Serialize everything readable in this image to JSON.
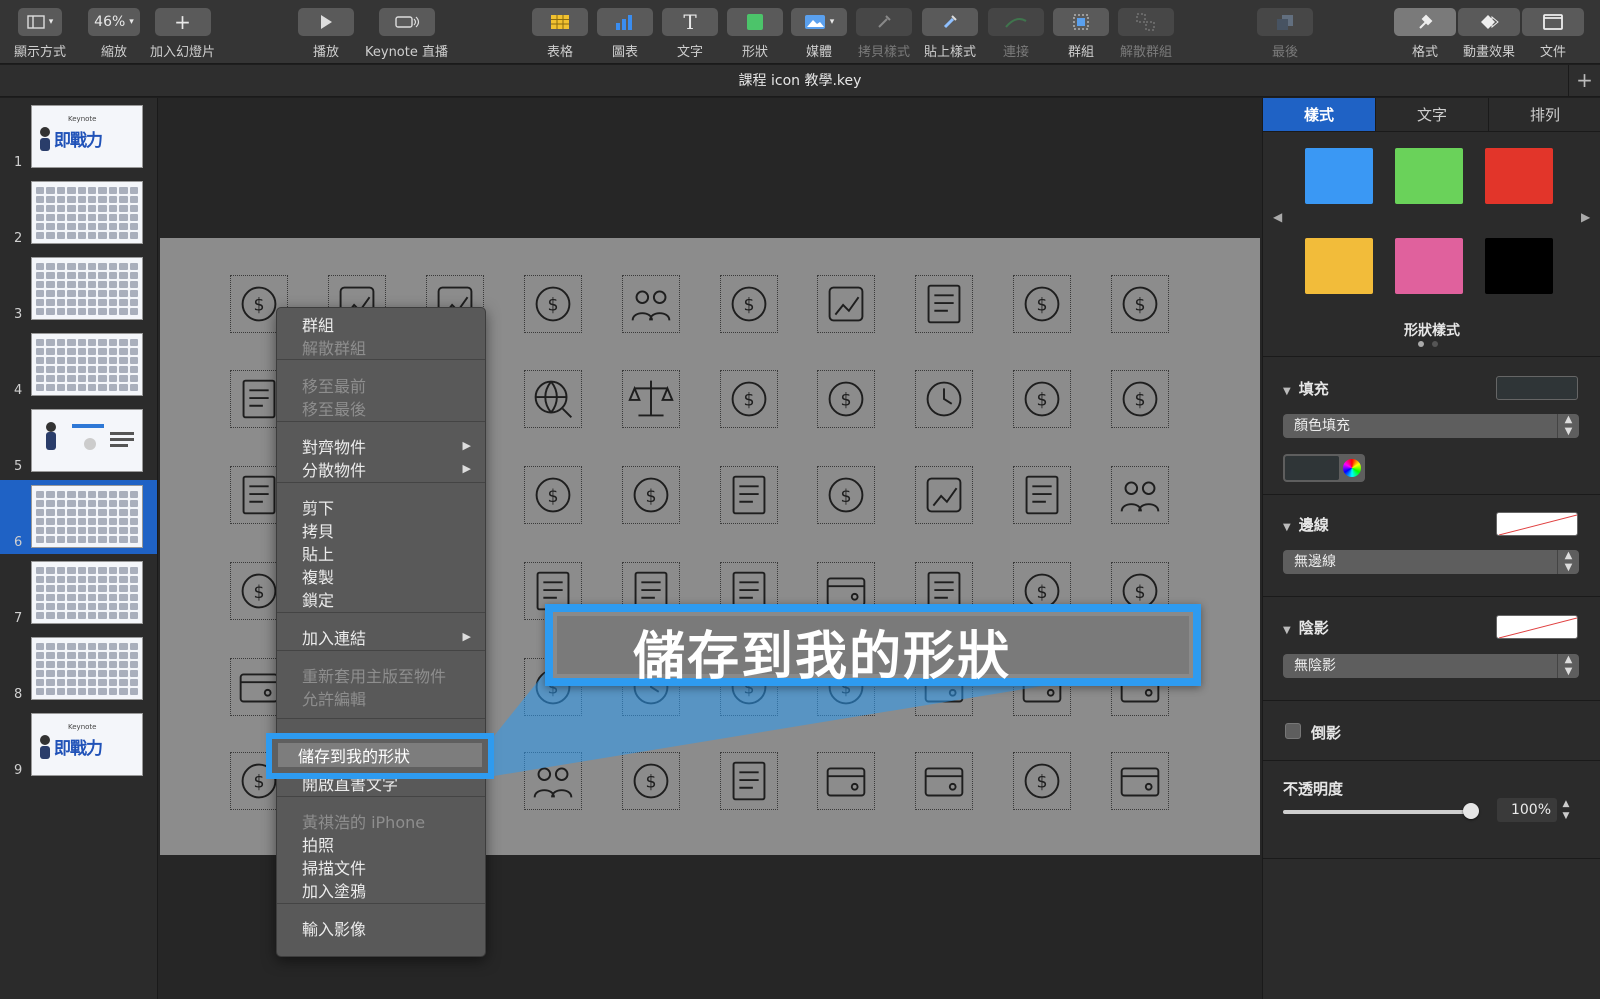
{
  "toolbar": {
    "view_label": "顯示方式",
    "zoom_value": "46%",
    "zoom_label": "縮放",
    "add_slide_label": "加入幻燈片",
    "play_label": "播放",
    "keynote_live_label": "Keynote 直播",
    "table_label": "表格",
    "chart_label": "圖表",
    "text_label": "文字",
    "shape_label": "形狀",
    "media_label": "媒體",
    "copy_style_label": "拷貝樣式",
    "paste_style_label": "貼上樣式",
    "connect_label": "連接",
    "group_label": "群組",
    "ungroup_label": "解散群組",
    "back_label": "最後",
    "format_label": "格式",
    "animate_label": "動畫效果",
    "document_label": "文件"
  },
  "document": {
    "title": "課程 icon 教學.key"
  },
  "navigator": {
    "slides": [
      {
        "num": "1",
        "kind": "title"
      },
      {
        "num": "2",
        "kind": "grid"
      },
      {
        "num": "3",
        "kind": "grid"
      },
      {
        "num": "4",
        "kind": "grid"
      },
      {
        "num": "5",
        "kind": "intro"
      },
      {
        "num": "6",
        "kind": "grid"
      },
      {
        "num": "7",
        "kind": "grid"
      },
      {
        "num": "8",
        "kind": "grid"
      },
      {
        "num": "9",
        "kind": "title"
      }
    ],
    "selected": "6",
    "thumb_title": "即戰力",
    "thumb_brand": "Keynote"
  },
  "context_menu": {
    "items": [
      {
        "label": "群組",
        "enabled": true
      },
      {
        "label": "解散群組",
        "enabled": false
      },
      {
        "label": "移至最前",
        "enabled": false
      },
      {
        "label": "移至最後",
        "enabled": false
      },
      {
        "label": "對齊物件",
        "enabled": true,
        "submenu": true
      },
      {
        "label": "分散物件",
        "enabled": true,
        "submenu": true
      },
      {
        "label": "剪下",
        "enabled": true
      },
      {
        "label": "拷貝",
        "enabled": true
      },
      {
        "label": "貼上",
        "enabled": true
      },
      {
        "label": "複製",
        "enabled": true
      },
      {
        "label": "鎖定",
        "enabled": true
      },
      {
        "label": "加入連結",
        "enabled": true,
        "submenu": true
      },
      {
        "label": "重新套用主版至物件",
        "enabled": false
      },
      {
        "label": "允許編輯",
        "enabled": false
      },
      {
        "label": "儲存到我的形狀",
        "enabled": true,
        "highlighted": true
      },
      {
        "label": "開啟直書文字",
        "enabled": true
      },
      {
        "label": "黃祺浩的 iPhone",
        "enabled": false
      },
      {
        "label": "拍照",
        "enabled": true
      },
      {
        "label": "掃描文件",
        "enabled": true
      },
      {
        "label": "加入塗鴉",
        "enabled": true
      },
      {
        "label": "輸入影像",
        "enabled": true
      }
    ]
  },
  "callout": {
    "text": "儲存到我的形狀"
  },
  "inspector": {
    "tabs": [
      "樣式",
      "文字",
      "排列"
    ],
    "active_tab": "樣式",
    "swatches": [
      "#3a98f4",
      "#6ad25a",
      "#e2352a",
      "#f2bc3a",
      "#e0619d",
      "#000000"
    ],
    "shape_styles_label": "形狀樣式",
    "fill": {
      "label": "填充",
      "type": "顏色填充"
    },
    "border": {
      "label": "邊線",
      "type": "無邊線"
    },
    "shadow": {
      "label": "陰影",
      "type": "無陰影"
    },
    "reflection": {
      "label": "倒影",
      "checked": false
    },
    "opacity": {
      "label": "不透明度",
      "value": "100%",
      "fraction": 1.0
    }
  },
  "slide": {
    "icon_rows": [
      [
        "dollar-coin",
        "auction",
        "contract",
        "growth-bag",
        "team",
        "network-dollar",
        "piggy-bank",
        "calendar-clock",
        "money-bag-coin",
        "money-bag"
      ],
      [
        "presentation",
        "globe-search",
        "balance-scale",
        "gears-dollar",
        "eye-dollar",
        "currency-exchange",
        "money-plant",
        "coins"
      ],
      [
        "checklist-clock",
        "search-dollar",
        "hand-money",
        "pie-report",
        "growth-coins",
        "strategy-chess",
        "percent-document",
        "group-people"
      ],
      [
        "document-dollar",
        "trend-board",
        "check-document",
        "resume-doc",
        "hand-card",
        "clipboard",
        "dollar-box",
        "cash-register"
      ],
      [
        "lock-card",
        "shield-dollar",
        "euro-exchange",
        "hand-coin",
        "dollar-bills",
        "credit-card",
        "laptop-pay",
        "wallet-card"
      ],
      [
        "card-dollar",
        "insurance-people",
        "cash-stack",
        "calculator",
        "safe-box",
        "clock-refresh",
        "dollar-refresh",
        "wallet"
      ]
    ]
  }
}
